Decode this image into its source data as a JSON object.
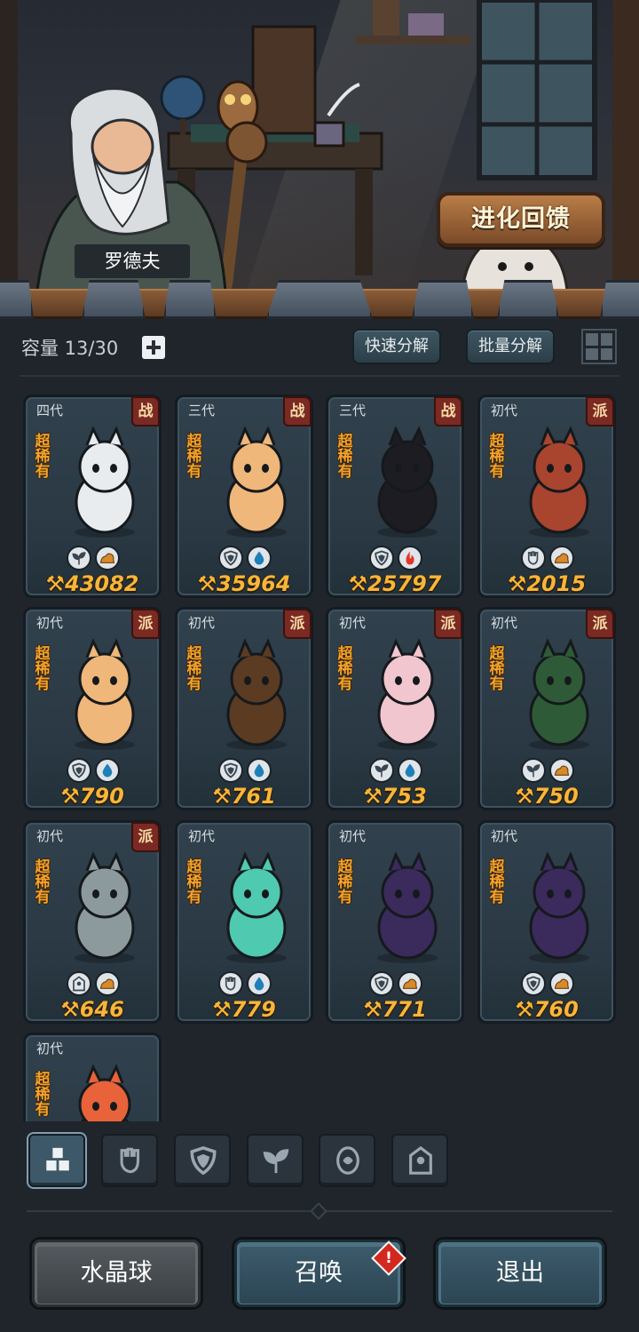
{
  "npc": {
    "name": "罗德夫"
  },
  "evolution_sign": "进化回馈",
  "capacity": {
    "text": "容量 13/30"
  },
  "toolbar": {
    "quick_decompose": "快速分解",
    "batch_decompose": "批量分解"
  },
  "cards": [
    {
      "gen": "四代",
      "badge": "战",
      "rarity": "超稀有",
      "power": "43082",
      "attrs": [
        "leaf-icon",
        "earth-icon"
      ],
      "sprite_color": "#e9ecef"
    },
    {
      "gen": "三代",
      "badge": "战",
      "rarity": "超稀有",
      "power": "35964",
      "attrs": [
        "shield-icon",
        "water-icon"
      ],
      "sprite_color": "#f0b77a"
    },
    {
      "gen": "三代",
      "badge": "战",
      "rarity": "超稀有",
      "power": "25797",
      "attrs": [
        "shield-icon",
        "fire-icon"
      ],
      "sprite_color": "#1c1c22"
    },
    {
      "gen": "初代",
      "badge": "派",
      "rarity": "超稀有",
      "power": "2015",
      "attrs": [
        "fist-icon",
        "earth-icon"
      ],
      "sprite_color": "#a9442f"
    },
    {
      "gen": "初代",
      "badge": "派",
      "rarity": "超稀有",
      "power": "790",
      "attrs": [
        "shield-icon",
        "water-icon"
      ],
      "sprite_color": "#f0b77a"
    },
    {
      "gen": "初代",
      "badge": "派",
      "rarity": "超稀有",
      "power": "761",
      "attrs": [
        "shield-icon",
        "water-icon"
      ],
      "sprite_color": "#5b3b22"
    },
    {
      "gen": "初代",
      "badge": "派",
      "rarity": "超稀有",
      "power": "753",
      "attrs": [
        "leaf-icon",
        "water-icon"
      ],
      "sprite_color": "#f2c6cf"
    },
    {
      "gen": "初代",
      "badge": "派",
      "rarity": "超稀有",
      "power": "750",
      "attrs": [
        "leaf-icon",
        "earth-icon"
      ],
      "sprite_color": "#2f5a37"
    },
    {
      "gen": "初代",
      "badge": "派",
      "rarity": "超稀有",
      "power": "646",
      "attrs": [
        "tower-icon",
        "earth-icon"
      ],
      "sprite_color": "#8c9a9d"
    },
    {
      "gen": "初代",
      "badge": "",
      "rarity": "超稀有",
      "power": "779",
      "attrs": [
        "fist-icon",
        "water-icon"
      ],
      "sprite_color": "#4fc9b0"
    },
    {
      "gen": "初代",
      "badge": "",
      "rarity": "超稀有",
      "power": "771",
      "attrs": [
        "shield-icon",
        "earth-icon"
      ],
      "sprite_color": "#3b2a5c"
    },
    {
      "gen": "初代",
      "badge": "",
      "rarity": "超稀有",
      "power": "760",
      "attrs": [
        "shield-icon",
        "earth-icon"
      ],
      "sprite_color": "#3b2a5c"
    },
    {
      "gen": "初代",
      "badge": "",
      "rarity": "超稀有",
      "power": "",
      "attrs": [],
      "sprite_color": "#e8623a"
    }
  ],
  "filters": [
    {
      "icon": "all-blocks-icon",
      "active": true
    },
    {
      "icon": "fist-icon",
      "active": false
    },
    {
      "icon": "shield-icon",
      "active": false
    },
    {
      "icon": "leaf-icon",
      "active": false
    },
    {
      "icon": "spirit-icon",
      "active": false
    },
    {
      "icon": "tower-icon",
      "active": false
    }
  ],
  "buttons": {
    "crystal_ball": "水晶球",
    "summon": "召唤",
    "exit": "退出",
    "summon_notice": "!"
  },
  "colors": {
    "power": "#f7b53a",
    "rarity": "#f2a32c",
    "badge": "#7a2a22",
    "notice": "#d3281f"
  }
}
